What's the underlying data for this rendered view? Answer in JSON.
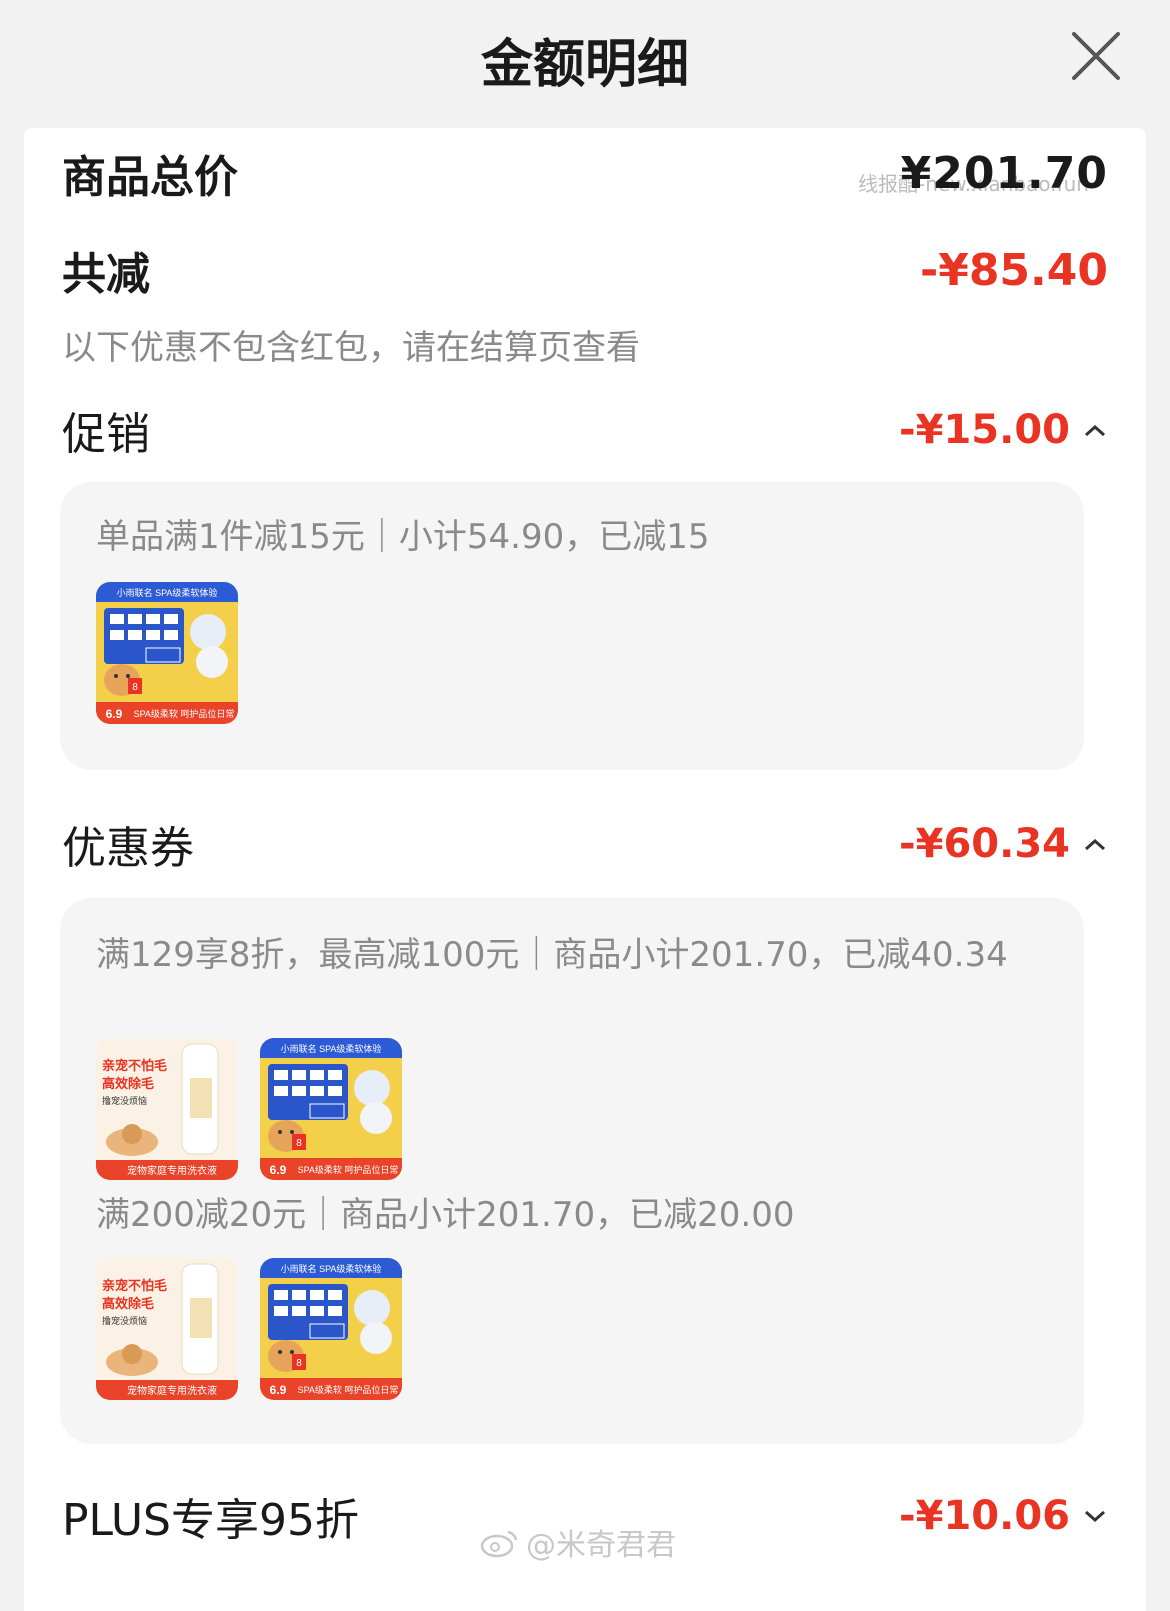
{
  "header": {
    "title": "金额明细"
  },
  "summary": {
    "total_label": "商品总价",
    "total_amount": "¥201.70",
    "discount_label": "共减",
    "discount_amount": "-¥85.40",
    "note": "以下优惠不包含红包，请在结算页查看"
  },
  "watermark": "线报酷-new.xianbao.fun",
  "promotion": {
    "label": "促销",
    "amount": "-¥15.00",
    "rule": "单品满1件减15元｜小计54.90，已减15",
    "products": [
      {
        "name": "tempo-tissue-product"
      }
    ]
  },
  "coupon": {
    "label": "优惠券",
    "amount": "-¥60.34",
    "groups": [
      {
        "rule": "满129享8折，最高减100元｜商品小计201.70，已减40.34",
        "products": [
          {
            "name": "pet-laundry-detergent",
            "text_1": "亲宠不怕毛",
            "text_2": "高效除毛",
            "text_3": "撸宠没烦恼",
            "text_4": "宠物家庭专用洗衣液"
          },
          {
            "name": "tempo-tissue-product"
          }
        ]
      },
      {
        "rule": "满200减20元｜商品小计201.70，已减20.00",
        "products": [
          {
            "name": "pet-laundry-detergent",
            "text_1": "亲宠不怕毛",
            "text_2": "高效除毛",
            "text_3": "撸宠没烦恼",
            "text_4": "宠物家庭专用洗衣液"
          },
          {
            "name": "tempo-tissue-product"
          }
        ]
      }
    ]
  },
  "tempo_text": {
    "top": "小雨联名 SPA级柔软体验",
    "bottom": "SPA级柔软 呵护品位日常",
    "badge": "8",
    "price_mark": "6.9"
  },
  "plus": {
    "label": "PLUS专享95折",
    "amount": "-¥10.06"
  },
  "weibo": {
    "handle": "@米奇君君"
  },
  "colors": {
    "accent": "#e93323",
    "muted": "#8a8a8a",
    "panel": "#f5f5f5"
  }
}
